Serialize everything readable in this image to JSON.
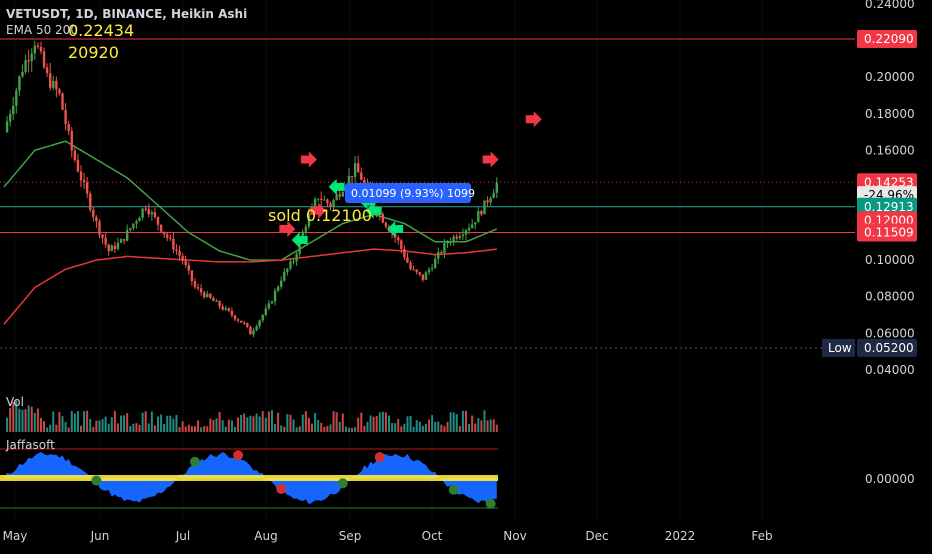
{
  "header": {
    "symbol_line": "VETUSDT, 1D, BINANCE, Heikin Ashi",
    "ema_line": "EMA 50 200",
    "volume_label": "Vol",
    "osc_label": "Jaffasoft"
  },
  "annotations": {
    "high_price": "0.22434",
    "high_sub": "20920",
    "sold_text": "sold 0.12100",
    "measure_text": "0.01099 (9.93%) 1099"
  },
  "price_tags": [
    {
      "text": "0.22090",
      "color": "#f23645",
      "value": 0.2209
    },
    {
      "text": "0.14253",
      "color": "#f23645",
      "value": 0.14253
    },
    {
      "text": "-24.96%",
      "color": "#e8e8e8",
      "value": 0.1355
    },
    {
      "text": "0.12913",
      "color": "#089981",
      "value": 0.12913
    },
    {
      "text": "0.12000",
      "color": "#f23645",
      "value": 0.1217
    },
    {
      "text": "0.11509",
      "color": "#f23645",
      "value": 0.11509
    },
    {
      "text": "0.05200",
      "color": "#1e2a44",
      "value": 0.052,
      "label": "Low"
    }
  ],
  "colors": {
    "background": "#000000",
    "bull": "#26a69a",
    "bull_ha": "#2e7d32",
    "bear": "#ef5350",
    "ema50": "#43a047",
    "ema200": "#e53935",
    "arrow_green": "#00e676",
    "arrow_red": "#f23645",
    "osc_fill": "#1565ff",
    "osc_zero": "#ffeb3b",
    "axis_text": "#d1d4dc"
  },
  "chart_data": {
    "type": "candlestick",
    "title": "VETUSDT, 1D, BINANCE, Heikin Ashi",
    "x_axis": {
      "labels": [
        "May",
        "Jun",
        "Jul",
        "Aug",
        "Sep",
        "Oct",
        "Nov",
        "Dec",
        "2022",
        "Feb"
      ]
    },
    "y_axis": {
      "scale": "linear",
      "range": [
        0.035,
        0.24
      ],
      "ticks": [
        "0.24000",
        "0.22000",
        "0.20000",
        "0.18000",
        "0.16000",
        "0.14000",
        "0.12000",
        "0.10000",
        "0.08000",
        "0.06000",
        "0.04000"
      ]
    },
    "price_path": [
      [
        0,
        0.17
      ],
      [
        6,
        0.205
      ],
      [
        10,
        0.22
      ],
      [
        14,
        0.2
      ],
      [
        18,
        0.19
      ],
      [
        22,
        0.16
      ],
      [
        26,
        0.14
      ],
      [
        30,
        0.12
      ],
      [
        34,
        0.105
      ],
      [
        38,
        0.11
      ],
      [
        42,
        0.12
      ],
      [
        46,
        0.13
      ],
      [
        50,
        0.12
      ],
      [
        54,
        0.11
      ],
      [
        58,
        0.1
      ],
      [
        62,
        0.085
      ],
      [
        66,
        0.08
      ],
      [
        70,
        0.075
      ],
      [
        74,
        0.07
      ],
      [
        78,
        0.065
      ],
      [
        80,
        0.06
      ],
      [
        82,
        0.065
      ],
      [
        86,
        0.075
      ],
      [
        90,
        0.09
      ],
      [
        94,
        0.1
      ],
      [
        98,
        0.12
      ],
      [
        102,
        0.135
      ],
      [
        106,
        0.13
      ],
      [
        110,
        0.14
      ],
      [
        114,
        0.15
      ],
      [
        116,
        0.145
      ],
      [
        120,
        0.13
      ],
      [
        124,
        0.12
      ],
      [
        128,
        0.11
      ],
      [
        132,
        0.095
      ],
      [
        136,
        0.09
      ],
      [
        140,
        0.1
      ],
      [
        144,
        0.11
      ],
      [
        148,
        0.115
      ],
      [
        152,
        0.12
      ],
      [
        156,
        0.13
      ],
      [
        160,
        0.142
      ]
    ],
    "ema50_path": [
      [
        0,
        0.14
      ],
      [
        10,
        0.16
      ],
      [
        20,
        0.165
      ],
      [
        30,
        0.155
      ],
      [
        40,
        0.145
      ],
      [
        50,
        0.13
      ],
      [
        60,
        0.115
      ],
      [
        70,
        0.105
      ],
      [
        80,
        0.1
      ],
      [
        90,
        0.1
      ],
      [
        100,
        0.11
      ],
      [
        110,
        0.12
      ],
      [
        120,
        0.125
      ],
      [
        130,
        0.12
      ],
      [
        140,
        0.11
      ],
      [
        150,
        0.11
      ],
      [
        160,
        0.117
      ]
    ],
    "ema200_path": [
      [
        0,
        0.065
      ],
      [
        10,
        0.085
      ],
      [
        20,
        0.095
      ],
      [
        30,
        0.1
      ],
      [
        40,
        0.102
      ],
      [
        50,
        0.101
      ],
      [
        60,
        0.1
      ],
      [
        70,
        0.099
      ],
      [
        80,
        0.099
      ],
      [
        90,
        0.1
      ],
      [
        100,
        0.102
      ],
      [
        110,
        0.104
      ],
      [
        120,
        0.106
      ],
      [
        130,
        0.105
      ],
      [
        140,
        0.103
      ],
      [
        150,
        0.104
      ],
      [
        160,
        0.106
      ]
    ],
    "signals": [
      {
        "type": "buy",
        "day": 108,
        "value": 0.14
      },
      {
        "type": "sell",
        "day": 99,
        "value": 0.155
      },
      {
        "type": "sell",
        "day": 102,
        "value": 0.127
      },
      {
        "type": "buy",
        "day": 118,
        "value": 0.132
      },
      {
        "type": "buy",
        "day": 120,
        "value": 0.127
      },
      {
        "type": "buy",
        "day": 127,
        "value": 0.117
      },
      {
        "type": "sell",
        "day": 92,
        "value": 0.117
      },
      {
        "type": "buy",
        "day": 96,
        "value": 0.111
      },
      {
        "type": "sell",
        "day": 158,
        "value": 0.155
      },
      {
        "type": "sell",
        "day": 172,
        "value": 0.177
      }
    ],
    "oscillator_zero": 0.0,
    "oscillator_label_value": "0.00000"
  }
}
